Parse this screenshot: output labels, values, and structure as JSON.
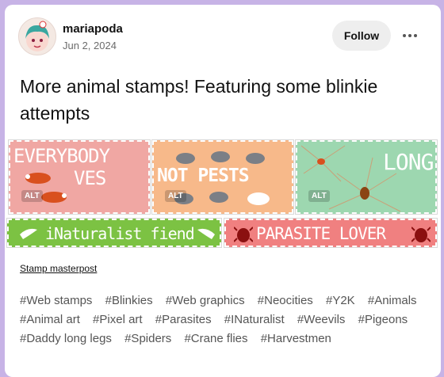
{
  "post": {
    "username": "mariapoda",
    "date": "Jun 2, 2024",
    "follow_label": "Follow",
    "title": "More animal stamps! Featuring some blinkie attempts"
  },
  "stamps": [
    {
      "text_line1": "EVERYBODY",
      "text_line2": "VES",
      "alt": "ALT",
      "bg": "#f0a7a3"
    },
    {
      "text": "NOT PESTS",
      "alt": "ALT",
      "bg": "#f7b98a"
    },
    {
      "text": "LONG",
      "alt": "ALT",
      "bg": "#9dd7b0"
    }
  ],
  "blinkies": [
    {
      "text": "iNaturalist fiend",
      "bg": "#7cc243"
    },
    {
      "text": "PARASITE LOVER",
      "bg": "#f08080"
    }
  ],
  "link_text": "Stamp masterpost",
  "tags": [
    "#Web stamps",
    "#Blinkies",
    "#Web graphics",
    "#Neocities",
    "#Y2K",
    "#Animals",
    "#Animal art",
    "#Pixel art",
    "#Parasites",
    "#INaturalist",
    "#Weevils",
    "#Pigeons",
    "#Daddy long legs",
    "#Spiders",
    "#Crane flies",
    "#Harvestmen"
  ],
  "colors": {
    "page_bg": "#c7b3e6",
    "card_bg": "#ffffff",
    "tag_color": "#555555"
  }
}
